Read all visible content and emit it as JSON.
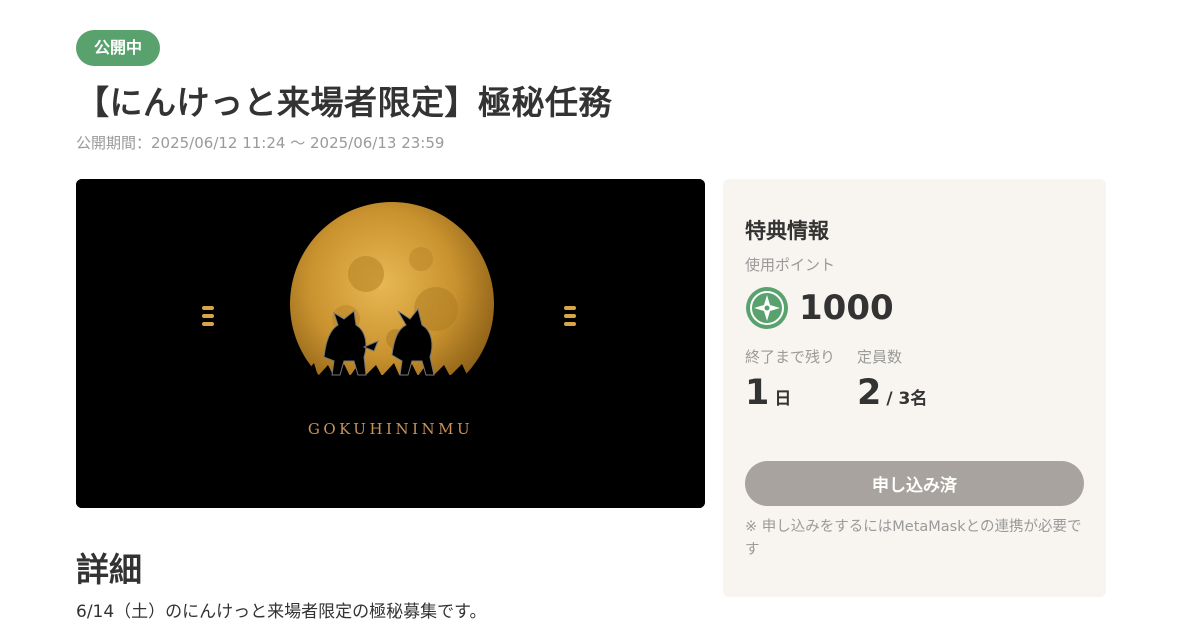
{
  "status": {
    "badge": "公開中",
    "color": "#5aa26d"
  },
  "campaign": {
    "title": "【にんけっと来場者限定】極秘任務",
    "period": "公開期間：2025/06/12 11:24 〜 2025/06/13 23:59"
  },
  "hero": {
    "caption": "GOKUHININMU",
    "icons": [
      "moon",
      "two-cats-silhouette",
      "lantern-left",
      "lantern-right"
    ]
  },
  "details": {
    "heading": "詳細",
    "body": "6/14（土）のにんけっと来場者限定の極秘募集です。"
  },
  "benefits": {
    "title": "特典情報",
    "points_label": "使用ポイント",
    "points_value": "1000",
    "point_icon": "shuriken-icon",
    "remaining_label": "終了まで残り",
    "remaining_value": "1",
    "remaining_unit": "日",
    "capacity_label": "定員数",
    "capacity_value": "2",
    "capacity_unit": "/ 3名",
    "apply_button": "申し込み済",
    "note": "※ 申し込みをするにはMetaMaskとの連携が必要です"
  },
  "colors": {
    "accent": "#5aa26d",
    "panel_bg": "#f8f5f0",
    "button_disabled": "#a8a39e"
  }
}
